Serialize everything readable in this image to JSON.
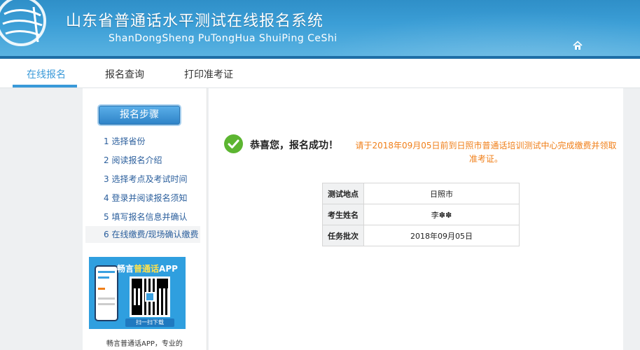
{
  "header": {
    "title_cn": "山东省普通话水平测试在线报名系统",
    "title_en": "ShanDongSheng PuTongHua ShuiPing CeShi",
    "home_icon": "home-icon"
  },
  "nav": {
    "items": [
      {
        "label": "在线报名",
        "active": true
      },
      {
        "label": "报名查询",
        "active": false
      },
      {
        "label": "打印准考证",
        "active": false
      }
    ],
    "accent_color": "#3a9ad9"
  },
  "sidebar": {
    "header": "报名步骤",
    "steps": [
      {
        "label": "1 选择省份"
      },
      {
        "label": "2 阅读报名介绍"
      },
      {
        "label": "3 选择考点及考试时间"
      },
      {
        "label": "4 登录并阅读报名须知"
      },
      {
        "label": "5 填写报名信息并确认"
      },
      {
        "label": "6 在线缴费/现场确认缴费"
      }
    ],
    "app": {
      "title_prefix": "畅言",
      "title_highlight": "普通话",
      "title_suffix": "APP",
      "scan_label": "扫一扫下载",
      "caption": "畅言普通话APP，专业的"
    }
  },
  "main": {
    "congrats": "恭喜您，报名成功！",
    "notice": "请于2018年09月05日前到日照市普通话培训测试中心完成缴费并领取准考证。",
    "notice_color": "#f07f19",
    "info": [
      {
        "key": "测试地点",
        "value": "日照市"
      },
      {
        "key": "考生姓名",
        "value": "李✽✽"
      },
      {
        "key": "任务批次",
        "value": "2018年09月05日"
      }
    ]
  }
}
